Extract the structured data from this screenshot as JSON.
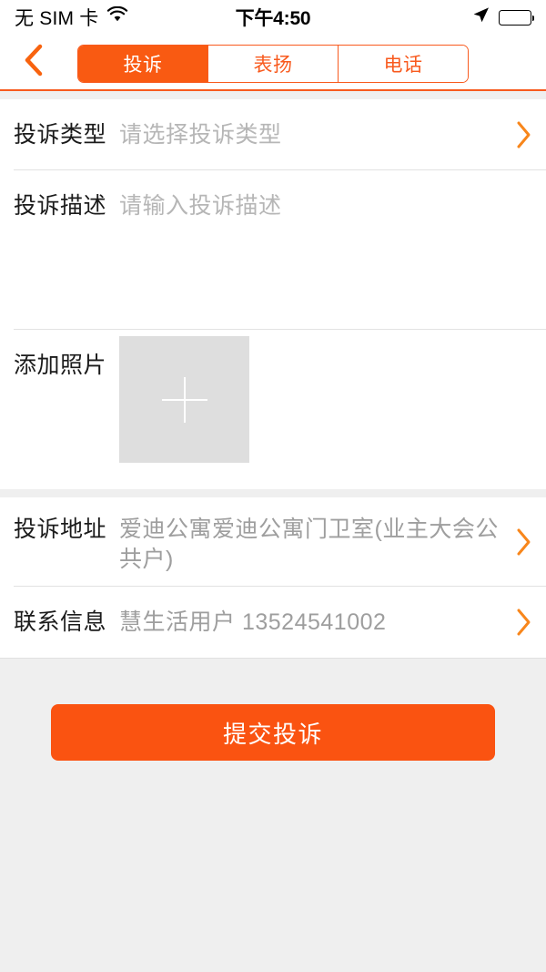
{
  "status_bar": {
    "carrier": "无 SIM 卡",
    "wifi_icon": "wifi-icon",
    "time": "下午4:50",
    "location_icon": "location-arrow-icon",
    "battery_icon": "battery-full-icon"
  },
  "nav": {
    "back_icon": "back-chevron-icon",
    "tabs": [
      {
        "label": "投诉",
        "active": true
      },
      {
        "label": "表扬",
        "active": false
      },
      {
        "label": "电话",
        "active": false
      }
    ]
  },
  "form": {
    "type_row": {
      "label": "投诉类型",
      "placeholder": "请选择投诉类型",
      "value": "",
      "chevron_icon": "chevron-right-icon"
    },
    "desc_row": {
      "label": "投诉描述",
      "placeholder": "请输入投诉描述",
      "value": ""
    },
    "photo_row": {
      "label": "添加照片",
      "add_icon": "plus-icon"
    },
    "address_row": {
      "label": "投诉地址",
      "value": "爱迪公寓爱迪公寓门卫室(业主大会公共户)",
      "chevron_icon": "chevron-right-icon"
    },
    "contact_row": {
      "label": "联系信息",
      "value": "慧生活用户 13524541002",
      "chevron_icon": "chevron-right-icon"
    }
  },
  "footer": {
    "submit_label": "提交投诉"
  },
  "colors": {
    "accent": "#fa5311",
    "tab_active_bg": "#f95a12",
    "tab_border": "#f85a1e",
    "page_bg": "#efefef",
    "card_bg": "#ffffff",
    "label_text": "#1b1b1b",
    "placeholder_text": "#b6b6b6",
    "value_text": "#9e9e9e",
    "photo_box_bg": "#dedede"
  }
}
